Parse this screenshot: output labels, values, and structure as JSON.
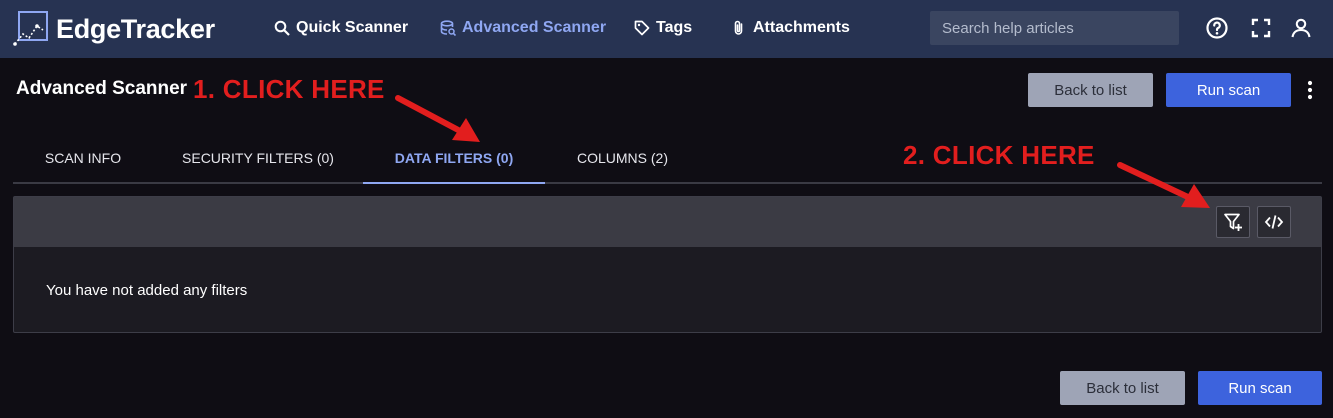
{
  "app": {
    "brand": "EdgeTracker",
    "accent": "#8fa7f2",
    "topbar_color": "#273352"
  },
  "nav": {
    "items": [
      {
        "label": "Quick Scanner",
        "icon": "search-icon"
      },
      {
        "label": "Advanced Scanner",
        "icon": "database-icon",
        "active": true
      },
      {
        "label": "Tags",
        "icon": "tag-icon"
      },
      {
        "label": "Attachments",
        "icon": "paperclip-icon"
      }
    ],
    "search_placeholder": "Search help articles"
  },
  "page": {
    "title": "Advanced Scanner",
    "back_label": "Back to list",
    "run_label": "Run scan"
  },
  "tabs": [
    {
      "label": "SCAN INFO"
    },
    {
      "label": "SECURITY FILTERS (0)"
    },
    {
      "label": "DATA FILTERS (0)",
      "active": true
    },
    {
      "label": "COLUMNS (2)"
    }
  ],
  "panel": {
    "empty_message": "You have not added any filters",
    "add_filter_icon": "filter-plus-icon",
    "code_icon": "code-icon"
  },
  "annotations": {
    "step1": "1. CLICK HERE",
    "step2": "2. CLICK HERE",
    "color": "#e21e1e"
  },
  "footer": {
    "back_label": "Back to list",
    "run_label": "Run scan"
  }
}
